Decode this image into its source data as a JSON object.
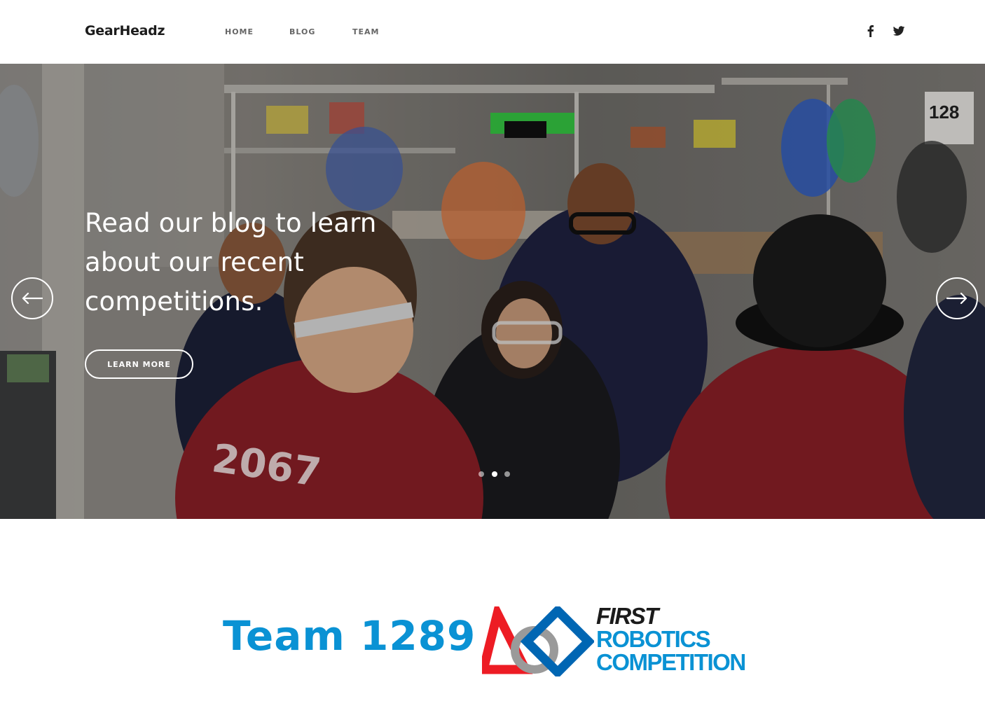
{
  "header": {
    "logo": "GearHeadz",
    "nav": [
      {
        "label": "HOME"
      },
      {
        "label": "BLOG"
      },
      {
        "label": "TEAM"
      }
    ],
    "social": [
      {
        "icon": "facebook-icon"
      },
      {
        "icon": "twitter-icon"
      }
    ]
  },
  "hero": {
    "heading": "Read our blog to learn about our recent competitions.",
    "button_label": "LEARN MORE",
    "prev_icon": "arrow-left-icon",
    "next_icon": "arrow-right-icon",
    "slides": 3,
    "active_slide": 2
  },
  "banner": {
    "team": "Team 1289",
    "frc_first": "FIRST",
    "frc_line1": "ROBOTICS",
    "frc_line2": "COMPETITION"
  },
  "colors": {
    "brand_blue": "#0a92d4",
    "frc_red": "#ed1c24",
    "frc_blue": "#0066b3",
    "frc_gray": "#9a9a9a"
  }
}
